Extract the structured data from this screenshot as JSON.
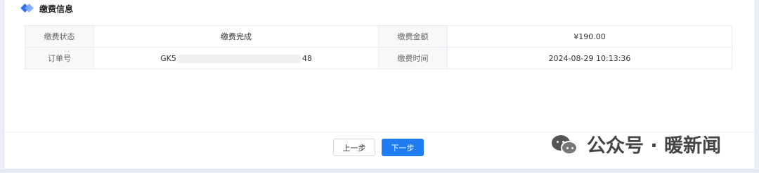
{
  "section": {
    "title": "缴费信息",
    "icon": "diamond-icon"
  },
  "table": {
    "rows": [
      {
        "label1": "缴费状态",
        "value1": "缴费完成",
        "label2": "缴费金额",
        "value2": "¥190.00"
      },
      {
        "label1": "订单号",
        "value1_prefix": "GK5",
        "value1_suffix": "48",
        "label2": "缴费时间",
        "value2": "2024-08-29 10:13:36"
      }
    ]
  },
  "footer": {
    "prev_label": "上一步",
    "next_label": "下一步"
  },
  "watermark": {
    "text": "公众号 · 暖新闻",
    "icon": "wechat-icon"
  },
  "colors": {
    "accent": "#1f7cf2",
    "label_bg": "#f7f8fa"
  }
}
